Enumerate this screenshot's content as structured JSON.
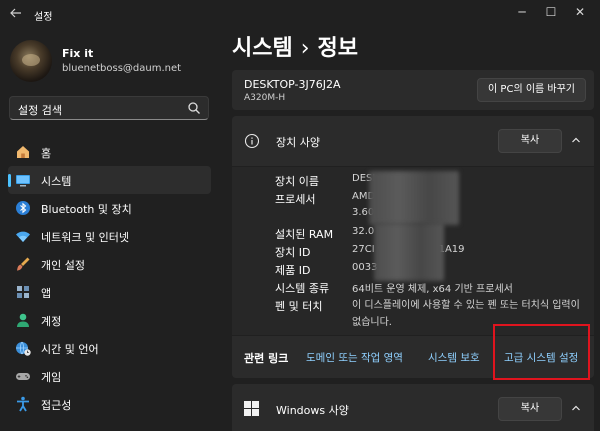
{
  "window": {
    "title": "설정",
    "back_icon": "arrow-left-icon",
    "minimize": "─",
    "maximize": "☐",
    "close": "✕"
  },
  "profile": {
    "name": "Fix it",
    "email": "bluenetboss@daum.net"
  },
  "search": {
    "placeholder": "설정 검색"
  },
  "nav": {
    "items": [
      {
        "label": "홈",
        "icon": "home-icon"
      },
      {
        "label": "시스템",
        "icon": "monitor-icon",
        "selected": true
      },
      {
        "label": "Bluetooth 및 장치",
        "icon": "bluetooth-icon"
      },
      {
        "label": "네트워크 및 인터넷",
        "icon": "wifi-icon"
      },
      {
        "label": "개인 설정",
        "icon": "brush-icon"
      },
      {
        "label": "앱",
        "icon": "apps-icon"
      },
      {
        "label": "계정",
        "icon": "person-icon"
      },
      {
        "label": "시간 및 언어",
        "icon": "globe-clock-icon"
      },
      {
        "label": "게임",
        "icon": "gamepad-icon"
      },
      {
        "label": "접근성",
        "icon": "accessibility-icon"
      }
    ]
  },
  "page": {
    "breadcrumb_root": "시스템",
    "separator": "›",
    "breadcrumb_current": "정보"
  },
  "device": {
    "name": "DESKTOP-3J76J2A",
    "model": "A320M-H",
    "rename_label": "이 PC의 이름 바꾸기"
  },
  "device_specs": {
    "title": "장치 사양",
    "copy_label": "복사",
    "rows": [
      {
        "key": "장치 이름",
        "value": "DESI"
      },
      {
        "key": "프로세서",
        "value": "AMD                                         ore Processor"
      },
      {
        "key": "",
        "value": "3.60"
      },
      {
        "key": "설치된 RAM",
        "value": "32.0"
      },
      {
        "key": "장치 ID",
        "value": "27CI                                       9-F012173B1A19"
      },
      {
        "key": "제품 ID",
        "value": "0033                                       '3"
      },
      {
        "key": "시스템 종류",
        "value": "64비트 운영 체제, x64 기반 프로세서"
      },
      {
        "key": "펜 및 터치",
        "value": "이 디스플레이에 사용할 수 있는 펜 또는 터치식 입력이 없습니다."
      }
    ]
  },
  "related_links": {
    "label": "관련 링크",
    "links": [
      "도메인 또는 작업 영역",
      "시스템 보호",
      "고급 시스템 설정"
    ]
  },
  "windows_specs": {
    "title": "Windows 사양",
    "copy_label": "복사"
  },
  "colors": {
    "accent": "#4cc2ff",
    "link": "#8fd0ff",
    "highlight": "#e0141e",
    "background": "#202020"
  }
}
